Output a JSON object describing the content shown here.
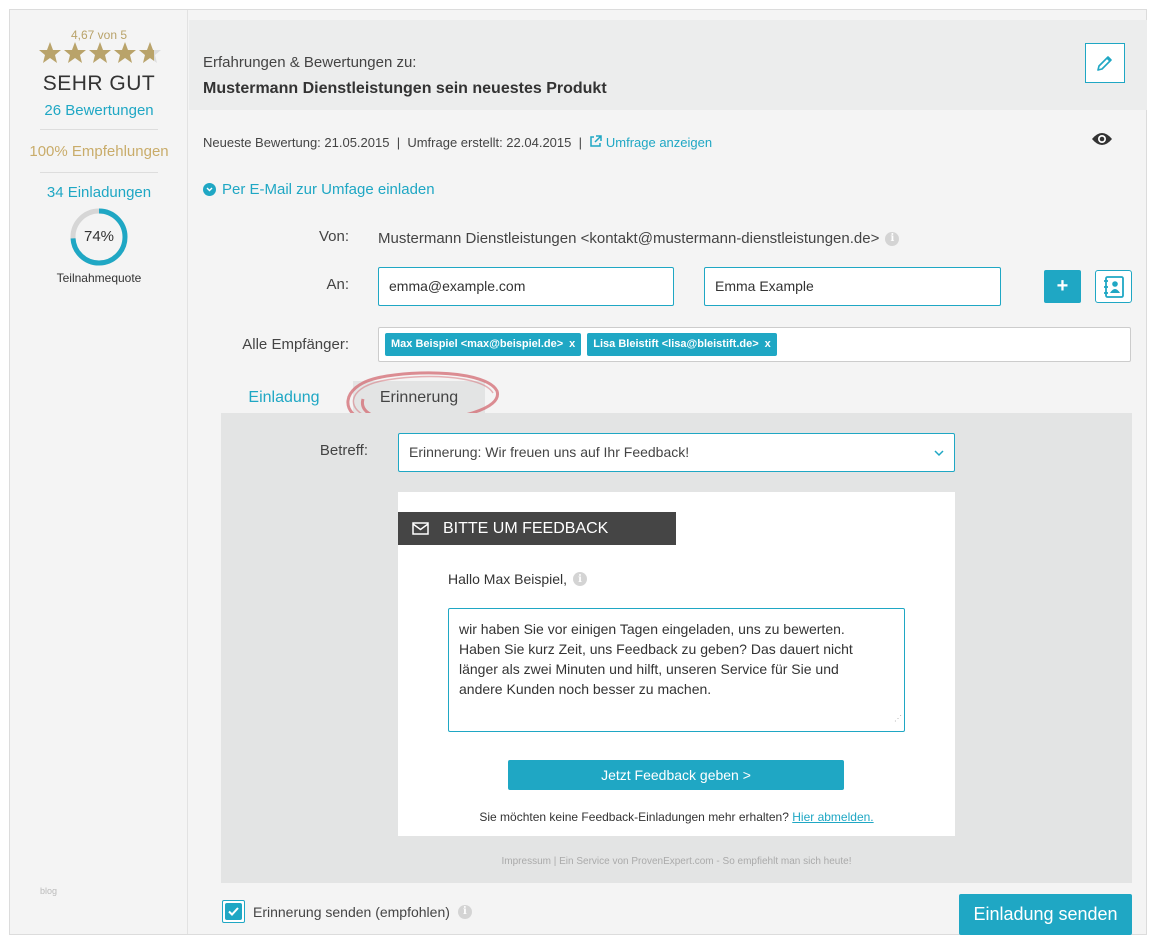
{
  "sidebar": {
    "score": "4,67 von 5",
    "rating_value": 4.67,
    "rating_max": 5,
    "grade": "SEHR GUT",
    "reviews": "26 Bewertungen",
    "recommendations": "100% Empfehlungen",
    "invitations": "34 Einladungen",
    "participation_percent": 74,
    "participation_label": "74%",
    "participation_caption": "Teilnahmequote",
    "footer": "blog",
    "colors": {
      "accent": "#1fa7c4",
      "gold": "#c9ac6a"
    }
  },
  "header": {
    "subtitle": "Erfahrungen & Bewertungen zu:",
    "title": "Mustermann Dienstleistungen sein neuestes Produkt",
    "edit_icon": "pencil-icon"
  },
  "meta": {
    "latest": "Neueste Bewertung: 21.05.2015",
    "created": "Umfrage erstellt: 22.04.2015",
    "separator": "|",
    "view_link": "Umfrage anzeigen",
    "eye_icon": "eye-icon"
  },
  "invite": {
    "toggle_label": "Per E-Mail zur Umfage einladen",
    "from_label": "Von:",
    "from_value": "Mustermann Dienstleistungen <kontakt@mustermann-dienstleistungen.de>",
    "to_label": "An:",
    "to_email": "emma@example.com",
    "to_name": "Emma Example",
    "plus_label": "+",
    "all_label": "Alle Empfänger:",
    "recipients": [
      {
        "label": "Max Beispiel <max@beispiel.de>",
        "remove": "x"
      },
      {
        "label": "Lisa Bleistift <lisa@bleistift.de>",
        "remove": "x"
      }
    ]
  },
  "tabs": [
    {
      "label": "Einladung",
      "active": false
    },
    {
      "label": "Erinnerung",
      "active": true
    }
  ],
  "email": {
    "subject_label": "Betreff:",
    "subject_value": "Erinnerung: Wir freuen uns auf Ihr Feedback!",
    "banner": "BITTE UM FEEDBACK",
    "greeting": "Hallo Max Beispiel,",
    "body_lines": [
      "wir haben Sie vor einigen Tagen eingeladen, uns zu bewerten.",
      "Haben Sie kurz Zeit, uns Feedback zu geben? Das dauert nicht",
      "länger als zwei Minuten und hilft, unseren Service für Sie und",
      "andere Kunden noch besser zu machen."
    ],
    "cta": "Jetzt Feedback geben >",
    "unsubscribe_text": "Sie möchten keine Feedback-Einladungen mehr erhalten?",
    "unsubscribe_link": "Hier abmelden.",
    "footer": "Impressum | Ein Service von ProvenExpert.com - So empfiehlt man sich heute!"
  },
  "actions": {
    "reminder_label": "Erinnerung senden (empfohlen)",
    "reminder_checked": true,
    "send": "Einladung senden"
  },
  "info_glyph": "i"
}
